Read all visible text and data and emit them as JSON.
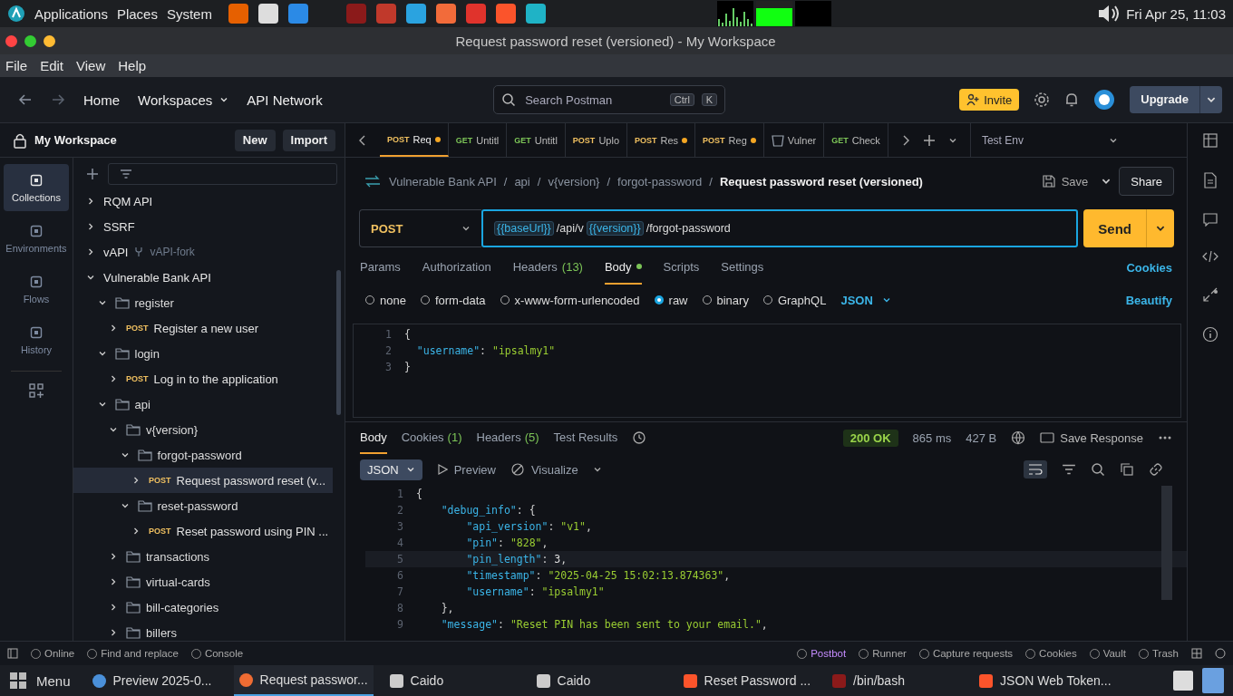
{
  "desktop_panel": {
    "menus": [
      "Applications",
      "Places",
      "System"
    ],
    "clock": "Fri Apr 25, 11:03"
  },
  "window": {
    "title": "Request password reset (versioned) - My Workspace"
  },
  "menu_bar": [
    "File",
    "Edit",
    "View",
    "Help"
  ],
  "header": {
    "nav": [
      {
        "label": "Home",
        "dropdown": false
      },
      {
        "label": "Workspaces",
        "dropdown": true
      },
      {
        "label": "API Network",
        "dropdown": false
      }
    ],
    "search": {
      "placeholder": "Search Postman",
      "keys": [
        "Ctrl",
        "K"
      ]
    },
    "invite": "Invite",
    "upgrade": "Upgrade"
  },
  "sidebar": {
    "workspace": "My Workspace",
    "buttons": [
      "New",
      "Import"
    ],
    "rail": [
      {
        "label": "Collections",
        "selected": true
      },
      {
        "label": "Environments",
        "selected": false
      },
      {
        "label": "Flows",
        "selected": false
      },
      {
        "label": "History",
        "selected": false
      }
    ],
    "tree": [
      {
        "kind": "collection",
        "label": "RQM API",
        "expanded": false,
        "selected": false
      },
      {
        "kind": "collection",
        "label": "SSRF",
        "expanded": false,
        "selected": false
      },
      {
        "kind": "collection",
        "label": "vAPI",
        "fork": "vAPI-fork",
        "expanded": false,
        "selected": false
      },
      {
        "kind": "collection",
        "label": "Vulnerable Bank API",
        "expanded": true,
        "selected": false,
        "children": [
          {
            "kind": "folder",
            "label": "register",
            "expanded": true,
            "selected": false,
            "children": [
              {
                "kind": "request",
                "method": "POST",
                "label": "Register a new user",
                "expanded": false,
                "selected": false
              }
            ]
          },
          {
            "kind": "folder",
            "label": "login",
            "expanded": true,
            "selected": false,
            "children": [
              {
                "kind": "request",
                "method": "POST",
                "label": "Log in to the application",
                "expanded": false,
                "selected": false
              }
            ]
          },
          {
            "kind": "folder",
            "label": "api",
            "expanded": true,
            "selected": false,
            "children": [
              {
                "kind": "folder",
                "label": "v{version}",
                "expanded": true,
                "selected": false,
                "children": [
                  {
                    "kind": "folder",
                    "label": "forgot-password",
                    "expanded": true,
                    "selected": false,
                    "children": [
                      {
                        "kind": "request",
                        "method": "POST",
                        "label": "Request password reset (v...",
                        "expanded": false,
                        "selected": true
                      }
                    ]
                  },
                  {
                    "kind": "folder",
                    "label": "reset-password",
                    "expanded": true,
                    "selected": false,
                    "children": [
                      {
                        "kind": "request",
                        "method": "POST",
                        "label": "Reset password using PIN ...",
                        "expanded": false,
                        "selected": false
                      }
                    ]
                  }
                ]
              },
              {
                "kind": "folder",
                "label": "transactions",
                "expanded": false,
                "selected": false
              },
              {
                "kind": "folder",
                "label": "virtual-cards",
                "expanded": false,
                "selected": false
              },
              {
                "kind": "folder",
                "label": "bill-categories",
                "expanded": false,
                "selected": false
              },
              {
                "kind": "folder",
                "label": "billers",
                "expanded": false,
                "selected": false
              }
            ]
          }
        ]
      }
    ]
  },
  "tabs": [
    {
      "kind": "request",
      "method": "POST",
      "label": "Req",
      "unsaved": true,
      "selected": true
    },
    {
      "kind": "request",
      "method": "GET",
      "label": "Untitl",
      "unsaved": false,
      "selected": false
    },
    {
      "kind": "request",
      "method": "GET",
      "label": "Untitl",
      "unsaved": false,
      "selected": false
    },
    {
      "kind": "request",
      "method": "POST",
      "label": "Uplo",
      "unsaved": false,
      "selected": false
    },
    {
      "kind": "request",
      "method": "POST",
      "label": "Res",
      "unsaved": true,
      "selected": false
    },
    {
      "kind": "request",
      "method": "POST",
      "label": "Reg",
      "unsaved": true,
      "selected": false
    },
    {
      "kind": "collection",
      "label": "Vulner",
      "unsaved": false,
      "selected": false
    },
    {
      "kind": "request",
      "method": "GET",
      "label": "Check",
      "unsaved": false,
      "selected": false
    }
  ],
  "environment": "Test Env",
  "breadcrumb": [
    "Vulnerable Bank API",
    "api",
    "v{version}",
    "forgot-password",
    "Request password reset (versioned)"
  ],
  "breadcrumb_separator": "/",
  "save": "Save",
  "share": "Share",
  "request": {
    "method": "POST",
    "url": [
      {
        "kind": "var",
        "text": "{{baseUrl}}"
      },
      {
        "kind": "text",
        "text": "/api/v"
      },
      {
        "kind": "var",
        "text": "{{version}}"
      },
      {
        "kind": "text",
        "text": "/forgot-password"
      }
    ],
    "send": "Send",
    "tabs": [
      {
        "label": "Params",
        "selected": false
      },
      {
        "label": "Authorization",
        "selected": false
      },
      {
        "label": "Headers",
        "count": "(13)",
        "selected": false
      },
      {
        "label": "Body",
        "dot": true,
        "selected": true
      },
      {
        "label": "Scripts",
        "selected": false
      },
      {
        "label": "Settings",
        "selected": false
      }
    ],
    "cookies": "Cookies",
    "body_modes": [
      {
        "label": "none",
        "selected": false
      },
      {
        "label": "form-data",
        "selected": false
      },
      {
        "label": "x-www-form-urlencoded",
        "selected": false
      },
      {
        "label": "raw",
        "selected": true
      },
      {
        "label": "binary",
        "selected": false
      },
      {
        "label": "GraphQL",
        "selected": false
      }
    ],
    "language": "JSON",
    "beautify": "Beautify",
    "body_lines": [
      {
        "n": "1",
        "current": false,
        "tokens": [
          {
            "kind": "punct",
            "s": "{"
          }
        ]
      },
      {
        "n": "2",
        "current": false,
        "tokens": [
          {
            "kind": "key",
            "s": "  \"username\""
          },
          {
            "kind": "punct",
            "s": ": "
          },
          {
            "kind": "string",
            "s": "\"ipsalmy1\""
          }
        ]
      },
      {
        "n": "3",
        "current": false,
        "tokens": [
          {
            "kind": "punct",
            "s": "}"
          }
        ]
      }
    ]
  },
  "response": {
    "tabs": [
      {
        "label": "Body",
        "selected": true
      },
      {
        "label": "Cookies",
        "count": "(1)",
        "selected": false
      },
      {
        "label": "Headers",
        "count": "(5)",
        "selected": false
      },
      {
        "label": "Test Results",
        "selected": false
      }
    ],
    "status": "200 OK",
    "time": "865 ms",
    "size": "427 B",
    "save": "Save Response",
    "format": "JSON",
    "preview": "Preview",
    "visualize": "Visualize",
    "lines": [
      {
        "n": "1",
        "current": false,
        "tokens": [
          {
            "kind": "punct",
            "s": "{"
          }
        ]
      },
      {
        "n": "2",
        "current": false,
        "tokens": [
          {
            "kind": "key",
            "s": "    \"debug_info\""
          },
          {
            "kind": "punct",
            "s": ": {"
          }
        ]
      },
      {
        "n": "3",
        "current": false,
        "tokens": [
          {
            "kind": "key",
            "s": "        \"api_version\""
          },
          {
            "kind": "punct",
            "s": ": "
          },
          {
            "kind": "string",
            "s": "\"v1\""
          },
          {
            "kind": "punct",
            "s": ","
          }
        ]
      },
      {
        "n": "4",
        "current": false,
        "tokens": [
          {
            "kind": "key",
            "s": "        \"pin\""
          },
          {
            "kind": "punct",
            "s": ": "
          },
          {
            "kind": "string",
            "s": "\"828\""
          },
          {
            "kind": "punct",
            "s": ","
          }
        ]
      },
      {
        "n": "5",
        "current": true,
        "tokens": [
          {
            "kind": "key",
            "s": "        \"pin_length\""
          },
          {
            "kind": "punct",
            "s": ": "
          },
          {
            "kind": "number",
            "s": "3"
          },
          {
            "kind": "punct",
            "s": ","
          }
        ]
      },
      {
        "n": "6",
        "current": false,
        "tokens": [
          {
            "kind": "key",
            "s": "        \"timestamp\""
          },
          {
            "kind": "punct",
            "s": ": "
          },
          {
            "kind": "string",
            "s": "\"2025-04-25 15:02:13.874363\""
          },
          {
            "kind": "punct",
            "s": ","
          }
        ]
      },
      {
        "n": "7",
        "current": false,
        "tokens": [
          {
            "kind": "key",
            "s": "        \"username\""
          },
          {
            "kind": "punct",
            "s": ": "
          },
          {
            "kind": "string",
            "s": "\"ipsalmy1\""
          }
        ]
      },
      {
        "n": "8",
        "current": false,
        "tokens": [
          {
            "kind": "punct",
            "s": "    },"
          }
        ]
      },
      {
        "n": "9",
        "current": false,
        "tokens": [
          {
            "kind": "key",
            "s": "    \"message\""
          },
          {
            "kind": "punct",
            "s": ": "
          },
          {
            "kind": "string",
            "s": "\"Reset PIN has been sent to your email.\""
          },
          {
            "kind": "punct",
            "s": ","
          }
        ]
      }
    ]
  },
  "status_bar": {
    "left": [
      "Online",
      "Find and replace",
      "Console"
    ],
    "right": [
      "Postbot",
      "Runner",
      "Capture requests",
      "Cookies",
      "Vault",
      "Trash"
    ]
  },
  "taskbar": {
    "menu": "Menu",
    "windows": [
      {
        "kind": "viewer",
        "label": "Preview 2025-0...",
        "selected": false
      },
      {
        "kind": "postman",
        "label": "Request passwor...",
        "selected": true
      },
      {
        "kind": "window",
        "label": "Caido",
        "selected": false
      },
      {
        "kind": "window",
        "label": "Caido",
        "selected": false
      },
      {
        "kind": "browser",
        "label": "Reset Password ...",
        "selected": false
      },
      {
        "kind": "terminal",
        "label": "/bin/bash",
        "selected": false
      },
      {
        "kind": "browser",
        "label": "JSON Web Token...",
        "selected": false
      }
    ]
  }
}
